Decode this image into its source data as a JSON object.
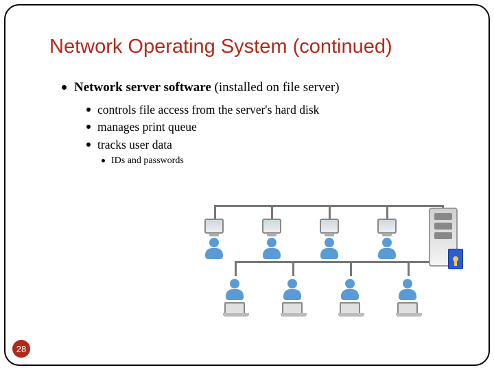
{
  "title": "Network Operating System (continued)",
  "bullets": {
    "main": {
      "bold": "Network server software",
      "rest": " (installed on file server)"
    },
    "sub": [
      "controls file access from the server's hard disk",
      "manages print queue",
      "tracks user data"
    ],
    "subsub": [
      "IDs and passwords"
    ]
  },
  "pageNumber": "28",
  "diagram": {
    "description": "Bus-topology LAN: four desktop workstations (top row) and four laptop users (bottom row) connected via a shared bus to a file server with a security/lock badge."
  },
  "colors": {
    "accent": "#b02a1a",
    "personBlue": "#5b9bd5",
    "badgeBlue": "#2b5cd1",
    "keyGold": "#f2c94c"
  }
}
